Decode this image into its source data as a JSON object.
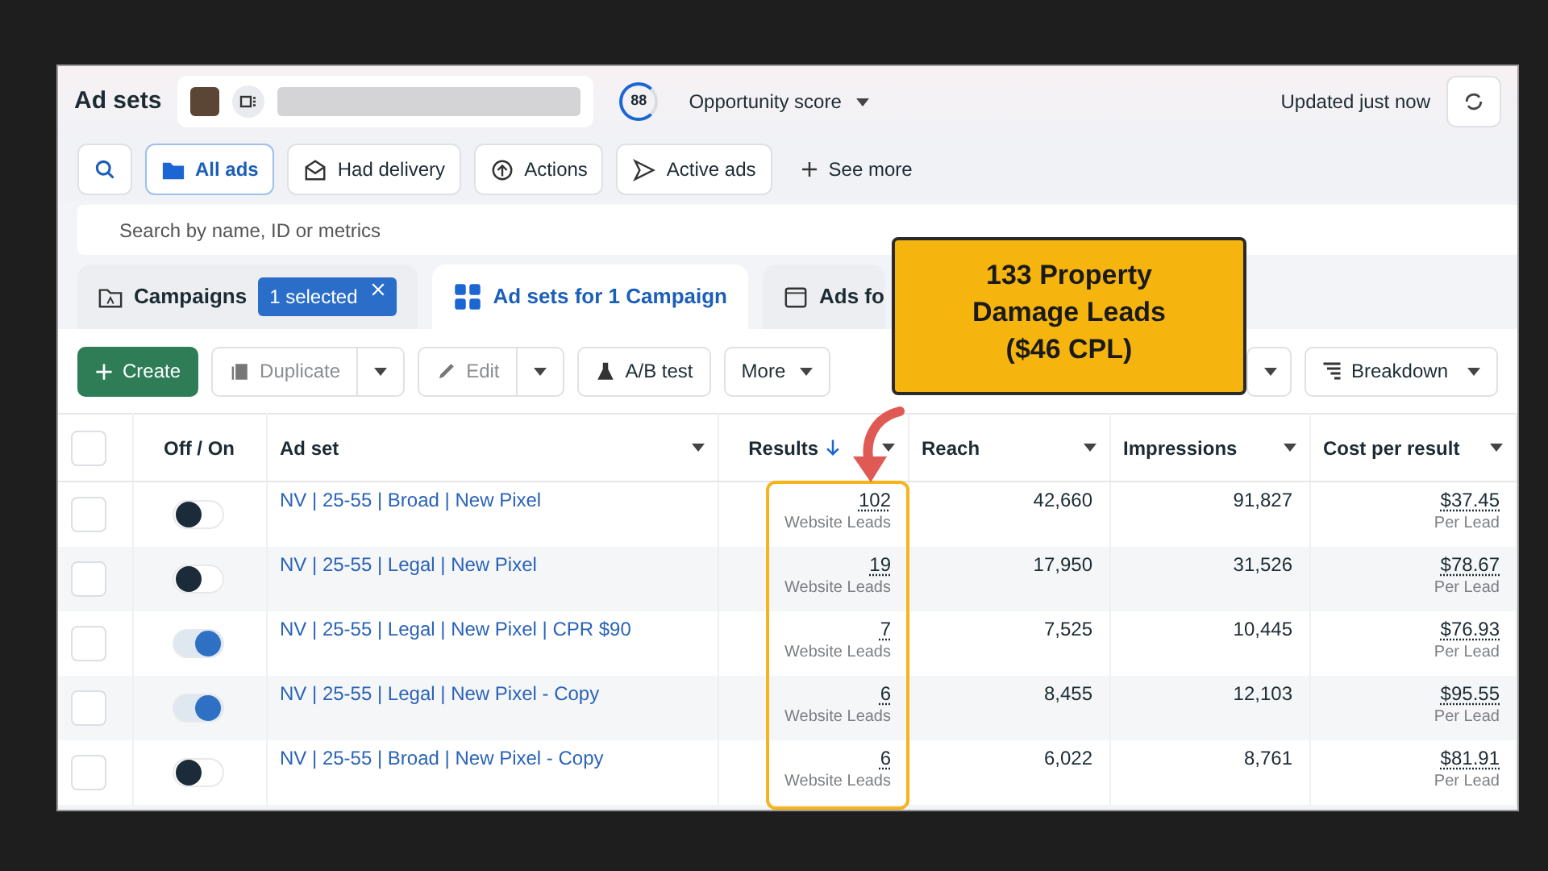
{
  "header": {
    "title": "Ad sets",
    "opportunity_score": "88",
    "opportunity_label": "Opportunity score",
    "updated": "Updated just now"
  },
  "filters": [
    {
      "label": "All ads",
      "selected": true
    },
    {
      "label": "Had delivery",
      "selected": false
    },
    {
      "label": "Actions",
      "selected": false
    },
    {
      "label": "Active ads",
      "selected": false
    }
  ],
  "see_more": "See more",
  "search": {
    "placeholder": "Search by name, ID or metrics"
  },
  "tabs": [
    {
      "label": "Campaigns",
      "selected": false,
      "badge": "1 selected"
    },
    {
      "label": "Ad sets for 1 Campaign",
      "selected": true
    },
    {
      "label": "Ads fo",
      "selected": false
    }
  ],
  "toolbar": {
    "create": "Create",
    "duplicate": {
      "label": "Duplicate",
      "disabled": true
    },
    "edit": {
      "label": "Edit",
      "disabled": true
    },
    "ab_test": "A/B test",
    "more": "More",
    "breakdown": "Breakdown"
  },
  "table": {
    "header_checked": false,
    "columns": [
      {
        "label": "Off / On",
        "sorted": false
      },
      {
        "label": "Ad set",
        "sorted": false
      },
      {
        "label": "Results",
        "sorted": true
      },
      {
        "label": "Reach",
        "sorted": false
      },
      {
        "label": "Impressions",
        "sorted": false
      },
      {
        "label": "Cost per result",
        "sorted": false
      }
    ],
    "rows": [
      {
        "checked": false,
        "on": false,
        "name": "NV | 25-55 | Broad | New Pixel",
        "results": "102",
        "results_label": "Website Leads",
        "reach": "42,660",
        "impressions": "91,827",
        "cost": "$37.45",
        "cost_label": "Per Lead"
      },
      {
        "checked": false,
        "on": false,
        "name": "NV | 25-55 | Legal | New Pixel",
        "results": "19",
        "results_label": "Website Leads",
        "reach": "17,950",
        "impressions": "31,526",
        "cost": "$78.67",
        "cost_label": "Per Lead"
      },
      {
        "checked": false,
        "on": true,
        "name": "NV | 25-55 | Legal | New Pixel | CPR $90",
        "results": "7",
        "results_label": "Website Leads",
        "reach": "7,525",
        "impressions": "10,445",
        "cost": "$76.93",
        "cost_label": "Per Lead"
      },
      {
        "checked": false,
        "on": true,
        "name": "NV | 25-55 | Legal | New Pixel - Copy",
        "results": "6",
        "results_label": "Website Leads",
        "reach": "8,455",
        "impressions": "12,103",
        "cost": "$95.55",
        "cost_label": "Per Lead"
      },
      {
        "checked": false,
        "on": false,
        "name": "NV | 25-55 | Broad | New Pixel - Copy",
        "results": "6",
        "results_label": "Website Leads",
        "reach": "6,022",
        "impressions": "8,761",
        "cost": "$81.91",
        "cost_label": "Per Lead"
      }
    ]
  },
  "callout": {
    "text": "133 Property\nDamage Leads\n($46 CPL)"
  }
}
